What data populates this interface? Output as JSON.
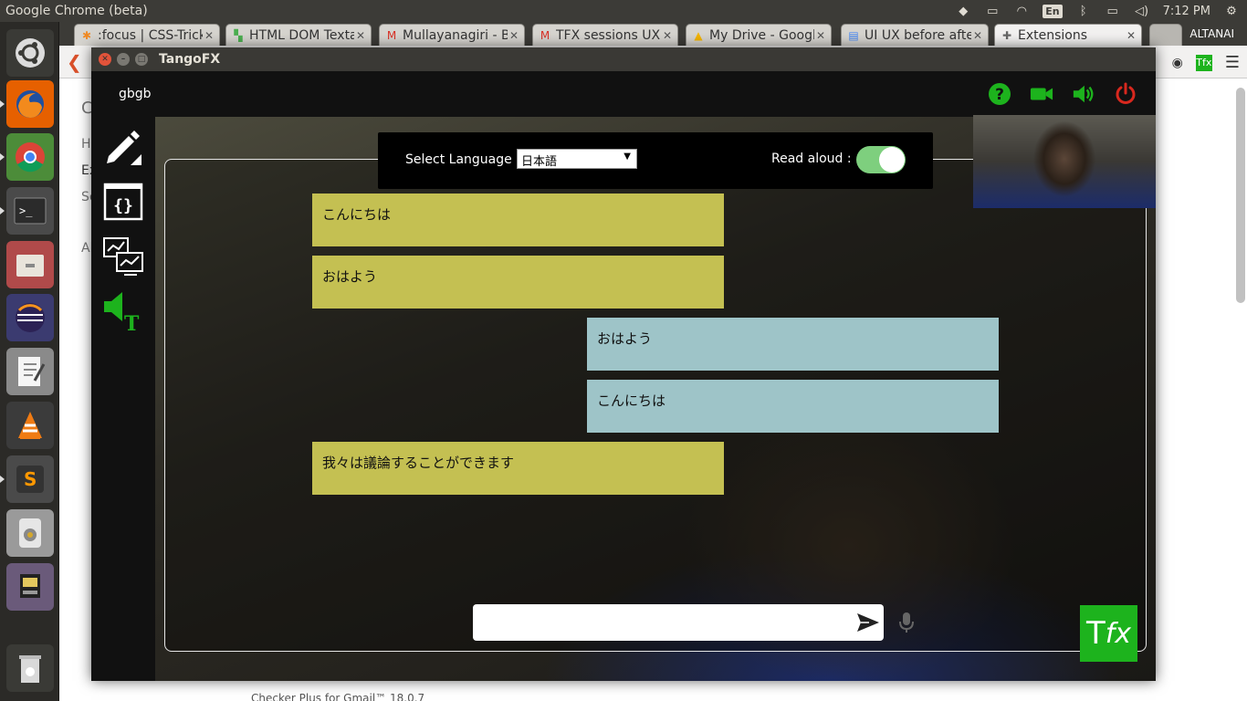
{
  "system": {
    "app_title": "Google Chrome (beta)",
    "keyboard_layout": "En",
    "clock": "7:12 PM"
  },
  "browser": {
    "tabs": [
      {
        "label": ":focus | CSS-Tricks",
        "icon": "css-tricks-icon"
      },
      {
        "label": "HTML DOM Textarea",
        "icon": "w3schools-icon"
      },
      {
        "label": "Mullayanagiri - B",
        "icon": "gmail-icon"
      },
      {
        "label": "TFX sessions UX",
        "icon": "gmail-icon"
      },
      {
        "label": "My Drive - Google",
        "icon": "google-drive-icon"
      },
      {
        "label": "UI UX before after",
        "icon": "google-docs-icon"
      },
      {
        "label": "Extensions",
        "icon": "puzzle-icon",
        "active": true
      }
    ],
    "profile_name": "ALTANAI",
    "page_side_items": [
      "C",
      "Hi",
      "Ex",
      "Se",
      "Al"
    ],
    "bottom_ext_label": "Checker Plus for Gmail™      18.0.7"
  },
  "app": {
    "window_title": "TangoFX",
    "username": "gbgb",
    "language_label": "Select Language :",
    "selected_language": "日本語",
    "read_aloud_label": "Read aloud :",
    "read_aloud_on": true,
    "compose_placeholder": "",
    "logo_text_t": "T",
    "logo_text_fx": "fx",
    "accent_color": "#1db31d",
    "danger_color": "#d9281e",
    "messages": [
      {
        "text": "こんにちは",
        "side": "left"
      },
      {
        "text": "おはよう",
        "side": "left"
      },
      {
        "text": "おはよう",
        "side": "right"
      },
      {
        "text": "こんにちは",
        "side": "right"
      },
      {
        "text": "我々は議論することができます",
        "side": "left"
      }
    ]
  }
}
